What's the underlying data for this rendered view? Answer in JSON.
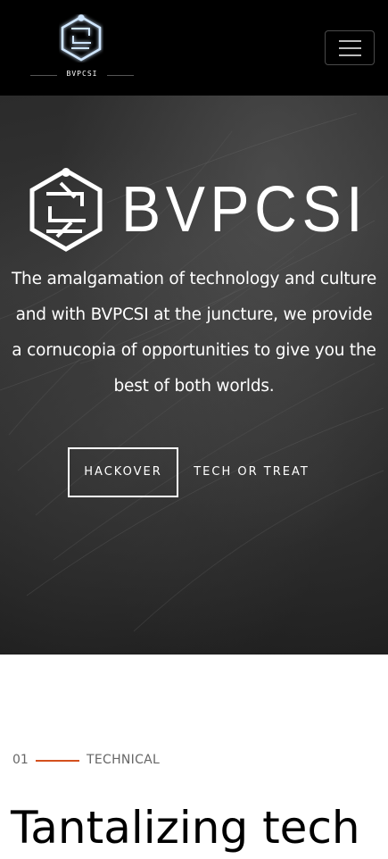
{
  "navbar": {
    "logo_text": "BVPCSI",
    "menu_icon": "hamburger-menu-icon"
  },
  "hero": {
    "logo_icon": "bvpcsi-hexagon-logo-icon",
    "title": "BVPCSI",
    "description": "The amalgamation of technology and culture and with BVPCSI at the juncture, we provide a cornucopia of opportunities to give you the best of both worlds.",
    "buttons": {
      "primary_label": "HACKOVER",
      "secondary_label": "TECH OR TREAT"
    }
  },
  "section": {
    "number": "01",
    "label": "TECHNICAL",
    "heading": "Tantalizing tech",
    "accent_color": "#d4501e"
  }
}
